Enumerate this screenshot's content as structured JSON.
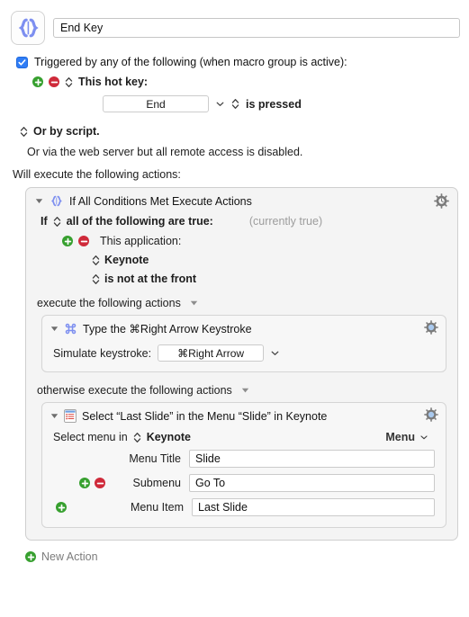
{
  "macro": {
    "icon": "braces-icon",
    "title": "End Key",
    "title_placeholder": "Macro Name"
  },
  "trigger": {
    "checkbox_checked": true,
    "label": "Triggered by any of the following (when macro group is active):",
    "hotkey_row": {
      "add_icon": "add-circle-icon",
      "remove_icon": "remove-circle-icon",
      "stepper_icon": "updown-stepper-icon",
      "label": "This hot key:"
    },
    "hotkey_value": "End",
    "hotkey_chevron": "chevron-down-icon",
    "hotkey_condition": "is pressed",
    "or_by_script": "Or by script.",
    "web_server_note": "Or via the web server but all remote access is disabled."
  },
  "actions_intro": "Will execute the following actions:",
  "if_action": {
    "disclosure": "disclosure-triangle-open",
    "icon": "braces-icon",
    "title": "If All Conditions Met Execute Actions",
    "gear_icon": "gear-icon",
    "condition_prefix": "If",
    "condition_selector": "all of the following are true:",
    "currently_state": "(currently true)",
    "this_application_label": "This application:",
    "application_name": "Keynote",
    "application_condition": "is not at the front",
    "then_label": "execute the following actions",
    "else_label": "otherwise execute the following actions"
  },
  "then_action": {
    "disclosure": "disclosure-triangle-open",
    "icon": "command-key-icon",
    "title": "Type the ⌘Right Arrow Keystroke",
    "gear_icon": "gear-icon-blue",
    "simulate_label": "Simulate keystroke:",
    "simulate_value": "⌘Right Arrow",
    "simulate_chevron": "chevron-down-icon"
  },
  "else_action": {
    "disclosure": "disclosure-triangle-open",
    "icon": "menu-list-icon",
    "title": "Select “Last Slide” in the Menu “Slide” in Keynote",
    "gear_icon": "gear-icon-blue",
    "select_menu_in_label": "Select menu in",
    "select_menu_app": "Keynote",
    "menu_button_label": "Menu",
    "menu_button_chevron": "chevron-down-icon",
    "fields": [
      {
        "label": "Menu Title",
        "value": "Slide",
        "has_add": false,
        "has_remove": false
      },
      {
        "label": "Submenu",
        "value": "Go To",
        "has_add": true,
        "has_remove": true
      },
      {
        "label": "Menu Item",
        "value": "Last Slide",
        "has_add": true,
        "has_remove": false
      }
    ]
  },
  "footer": {
    "new_action_icon": "add-circle-icon",
    "new_action_label": "New Action"
  },
  "colors": {
    "accent_blue": "#7d8ff0",
    "checkbox_blue": "#2f7df6",
    "add_green": "#37a02f",
    "remove_red": "#cf2a3a",
    "panel_bg": "#f4f4f4",
    "inner_panel_bg": "#f7f7f7",
    "dim_text": "#9d9d9d"
  }
}
